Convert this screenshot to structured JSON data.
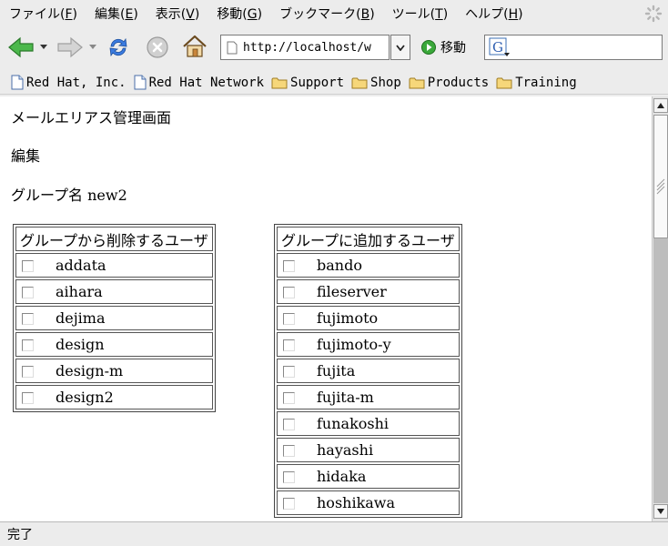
{
  "menu": [
    {
      "label": "ファイル(",
      "key": "F",
      "suffix": ")"
    },
    {
      "label": "編集(",
      "key": "E",
      "suffix": ")"
    },
    {
      "label": "表示(",
      "key": "V",
      "suffix": ")"
    },
    {
      "label": "移動(",
      "key": "G",
      "suffix": ")"
    },
    {
      "label": "ブックマーク(",
      "key": "B",
      "suffix": ")"
    },
    {
      "label": "ツール(",
      "key": "T",
      "suffix": ")"
    },
    {
      "label": "ヘルプ(",
      "key": "H",
      "suffix": ")"
    }
  ],
  "toolbar": {
    "url": "http://localhost/w",
    "go_label": "移動",
    "search_value": ""
  },
  "bookmarks": [
    {
      "label": "Red Hat, Inc.",
      "icon": "page-icon"
    },
    {
      "label": "Red Hat Network",
      "icon": "page-icon"
    },
    {
      "label": "Support",
      "icon": "folder-icon"
    },
    {
      "label": "Shop",
      "icon": "folder-icon"
    },
    {
      "label": "Products",
      "icon": "folder-icon"
    },
    {
      "label": "Training",
      "icon": "folder-icon"
    }
  ],
  "page": {
    "title": "メールエリアス管理画面",
    "subtitle": "編集",
    "group_label": "グループ名 new2",
    "remove_table": {
      "header": "グループから削除するユーザ",
      "users": [
        "addata",
        "aihara",
        "dejima",
        "design",
        "design-m",
        "design2"
      ]
    },
    "add_table": {
      "header": "グループに追加するユーザ",
      "users": [
        "bando",
        "fileserver",
        "fujimoto",
        "fujimoto-y",
        "fujita",
        "fujita-m",
        "funakoshi",
        "hayashi",
        "hidaka",
        "hoshikawa"
      ]
    }
  },
  "status": "完了",
  "colors": {
    "back_arrow": "#3aa83a",
    "reload": "#2f6fd0",
    "go": "#2c9a2c"
  }
}
